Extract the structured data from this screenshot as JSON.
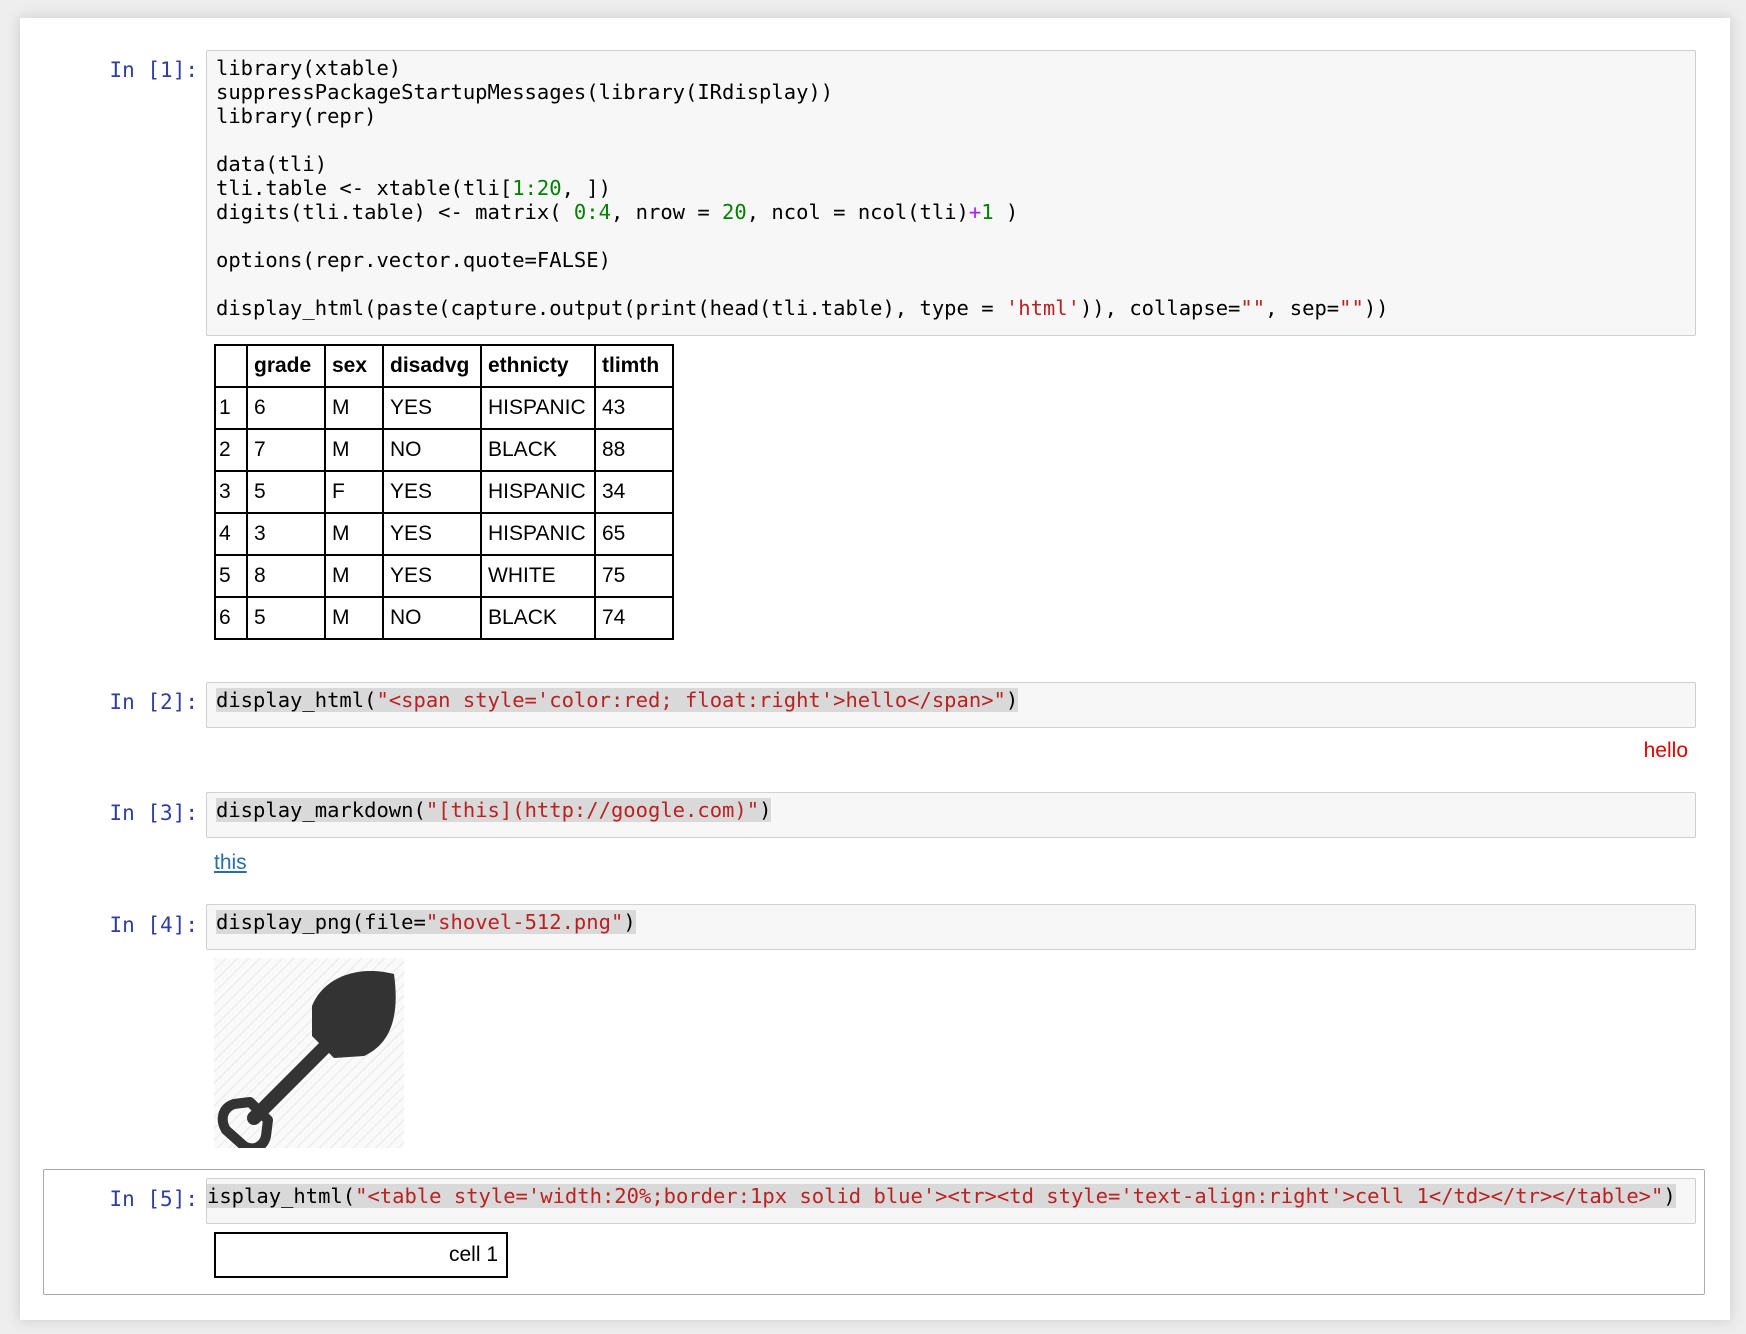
{
  "cells": [
    {
      "prompt": "In [1]:",
      "code_lines": [
        "library(xtable)",
        "suppressPackageStartupMessages(library(IRdisplay))",
        "library(repr)",
        "",
        "data(tli)",
        "tli.table <- xtable(tli[1:20, ])",
        "digits(tli.table) <- matrix( 0:4, nrow = 20, ncol = ncol(tli)+1 )",
        "",
        "options(repr.vector.quote=FALSE)",
        "",
        "display_html(paste(capture.output(print(head(tli.table), type = 'html')), collapse=\"\", sep=\"\"))"
      ],
      "output_table": {
        "headers": [
          "",
          "grade",
          "sex",
          "disadvg",
          "ethnicty",
          "tlimth"
        ],
        "rows": [
          [
            "1",
            "6",
            "M",
            "YES",
            "HISPANIC",
            "43"
          ],
          [
            "2",
            "7",
            "M",
            "NO",
            "BLACK",
            "88"
          ],
          [
            "3",
            "5",
            "F",
            "YES",
            "HISPANIC",
            "34"
          ],
          [
            "4",
            "3",
            "M",
            "YES",
            "HISPANIC",
            "65"
          ],
          [
            "5",
            "8",
            "M",
            "YES",
            "WHITE",
            "75"
          ],
          [
            "6",
            "5",
            "M",
            "NO",
            "BLACK",
            "74"
          ]
        ]
      }
    },
    {
      "prompt": "In [2]:",
      "code": "display_html(\"<span style='color:red; float:right'>hello</span>\")",
      "output_text": "hello"
    },
    {
      "prompt": "In [3]:",
      "code": "display_markdown(\"[this](http://google.com)\")",
      "output_link": "this"
    },
    {
      "prompt": "In [4]:",
      "code": "display_png(file=\"shovel-512.png\")",
      "output_image_icon": "shovel-icon"
    },
    {
      "prompt": "In [5]:",
      "code": "isplay_html(\"<table style='width:20%;border:1px solid blue'><tr><td style='text-align:right'>cell 1</td></tr></table>\")",
      "output_cell": "cell 1"
    }
  ],
  "colors": {
    "prompt": "#303f9f",
    "string": "#ba2121",
    "number": "#008000",
    "operator": "#aa22ff",
    "hello": "#dd0000",
    "link": "#296eaa"
  }
}
